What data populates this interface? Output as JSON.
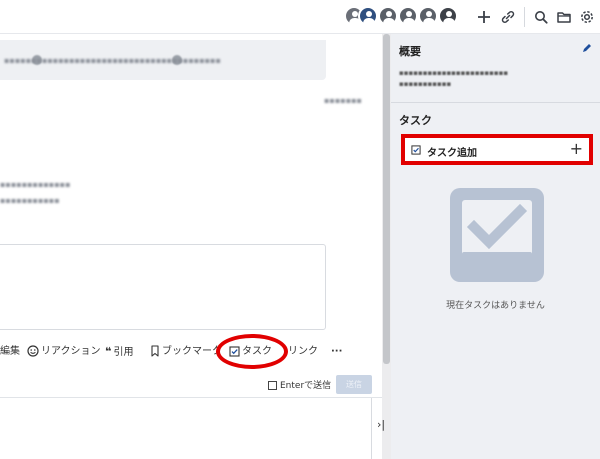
{
  "toolbar_icons": [
    "plus-icon",
    "link-icon",
    "search-icon",
    "folder-icon",
    "gear-icon"
  ],
  "chat": {
    "composer": {
      "tools": [
        {
          "name": "edit",
          "label": "編集",
          "icon": "pencil-icon"
        },
        {
          "name": "reaction",
          "label": "リアクション",
          "icon": "smile-icon"
        },
        {
          "name": "quote",
          "label": "引用",
          "icon": "quote-icon"
        },
        {
          "name": "bookmark",
          "label": "ブックマーク",
          "icon": "bookmark-icon"
        },
        {
          "name": "task",
          "label": "タスク",
          "icon": "checkbox-icon"
        },
        {
          "name": "link",
          "label": "リンク",
          "icon": "link-icon"
        },
        {
          "name": "more",
          "label": "···",
          "icon": "more-icon"
        }
      ],
      "enter_send_label": "Enterで送信",
      "send_label": "送信"
    }
  },
  "panel": {
    "overview_title": "概要",
    "task_title": "タスク",
    "task_add_label": "タスク追加",
    "empty_text": "現在タスクはありません"
  },
  "colors": {
    "highlight": "#e10000",
    "panel_bg": "#eef0f4",
    "accent": "#1f4f9c",
    "empty_icon": "#b7c2d3"
  }
}
